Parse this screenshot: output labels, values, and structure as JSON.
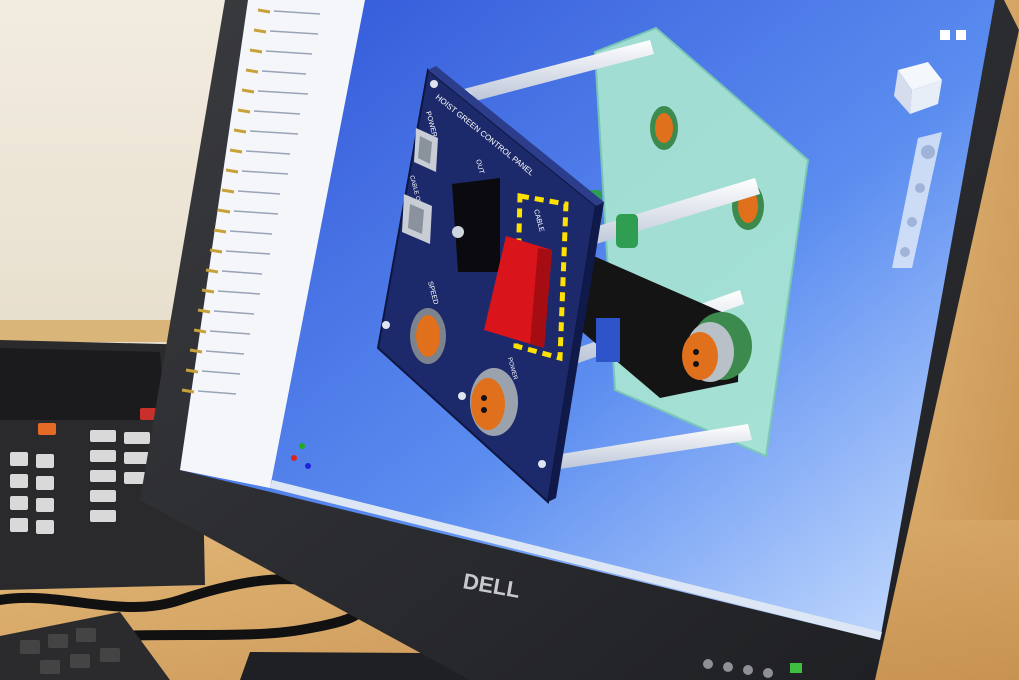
{
  "monitor": {
    "brand": "DELL"
  },
  "panel": {
    "heading": "HOIST GREEN CONTROL PANEL",
    "label_power": "POWER",
    "label_cable_out": "CABLE OUT",
    "label_out": "OUT",
    "label_cable": "CABLE",
    "label_speed": "SPEED",
    "label_power_bottom": "POWER"
  },
  "colors": {
    "viewport_blue": "#3f6fe0",
    "panel_navy": "#1c2a6b",
    "clear_plate": "#a9e6d2",
    "handle_red": "#d9141a",
    "connector_orange": "#e0701c",
    "desk_wood": "#d7a769"
  },
  "icons": [
    "view-cube-icon",
    "axis-triad-icon",
    "tree-folder-icon"
  ]
}
